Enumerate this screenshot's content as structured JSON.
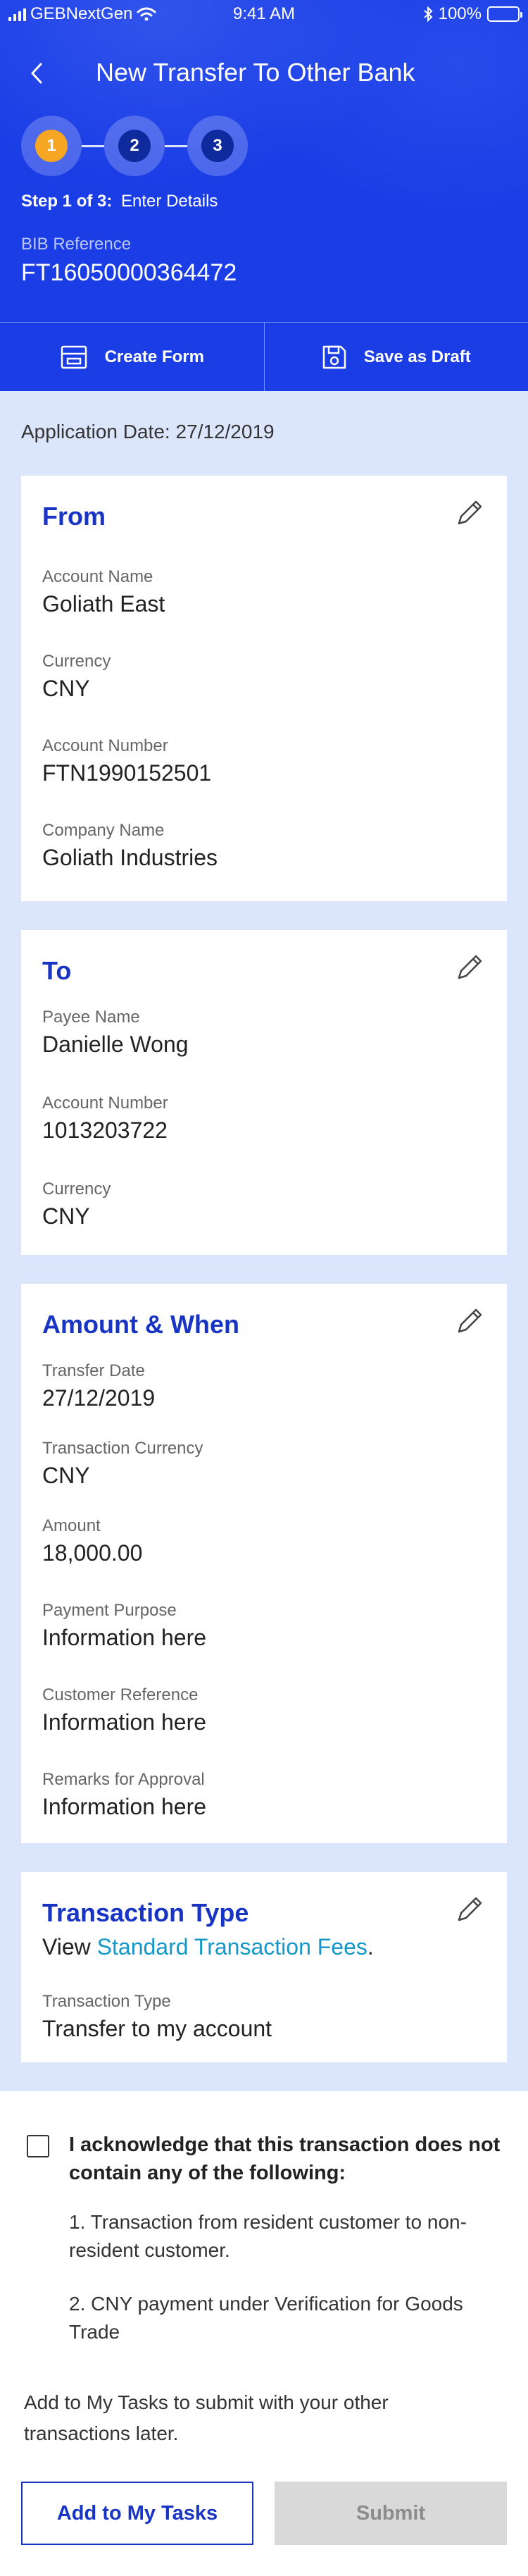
{
  "status_bar": {
    "carrier": "GEBNextGen",
    "time": "9:41 AM",
    "battery": "100%",
    "icons": [
      "signal-icon",
      "wifi-icon",
      "bluetooth-icon",
      "battery-icon"
    ]
  },
  "header": {
    "title": "New Transfer To Other Bank",
    "back_icon": "chevron-left-icon",
    "steps": [
      "1",
      "2",
      "3"
    ],
    "active_step": 1,
    "step_prefix": "Step 1 of 3:",
    "step_name": "Enter Details",
    "bib_label": "BIB Reference",
    "bib_value": "FT16050000364472",
    "colors": {
      "header_bg": "#1a3de6",
      "active_step": "#f5a623",
      "step_inner": "#0f2a9c"
    }
  },
  "actions": {
    "create_form": "Create Form",
    "save_draft": "Save as Draft"
  },
  "application_date": "Application Date: 27/12/2019",
  "from": {
    "title": "From",
    "fields": [
      {
        "label": "Account Name",
        "value": "Goliath East"
      },
      {
        "label": "Currency",
        "value": "CNY"
      },
      {
        "label": "Account Number",
        "value": "FTN1990152501"
      },
      {
        "label": "Company Name",
        "value": "Goliath Industries"
      }
    ]
  },
  "to": {
    "title": "To",
    "fields": [
      {
        "label": "Payee Name",
        "value": "Danielle Wong"
      },
      {
        "label": "Account Number",
        "value": "1013203722"
      },
      {
        "label": "Currency",
        "value": "CNY"
      }
    ]
  },
  "amount_when": {
    "title": "Amount & When",
    "fields": [
      {
        "label": "Transfer Date",
        "value": "27/12/2019"
      },
      {
        "label": "Transaction Currency",
        "value": "CNY"
      },
      {
        "label": "Amount",
        "value": "18,000.00"
      },
      {
        "label": "Payment Purpose",
        "value": "Information here"
      },
      {
        "label": "Customer Reference",
        "value": "Information here"
      },
      {
        "label": "Remarks for Approval",
        "value": "Information here"
      }
    ]
  },
  "transaction_type": {
    "title": "Transaction Type",
    "view_prefix": "View ",
    "view_link": "Standard Transaction Fees",
    "view_suffix": ".",
    "fields": [
      {
        "label": "Transaction Type",
        "value": "Transfer to my account"
      }
    ]
  },
  "acknowledgement": {
    "checked": false,
    "title": "I acknowledge that this transaction does not contain any of the following:",
    "items": [
      "1. Transaction from resident customer to non-resident customer.",
      "2. CNY payment under Verification for Goods Trade"
    ]
  },
  "footer": {
    "tasks_note": "Add to My Tasks to submit with your other transactions later.",
    "add_to_tasks": "Add to My Tasks",
    "submit": "Submit"
  }
}
